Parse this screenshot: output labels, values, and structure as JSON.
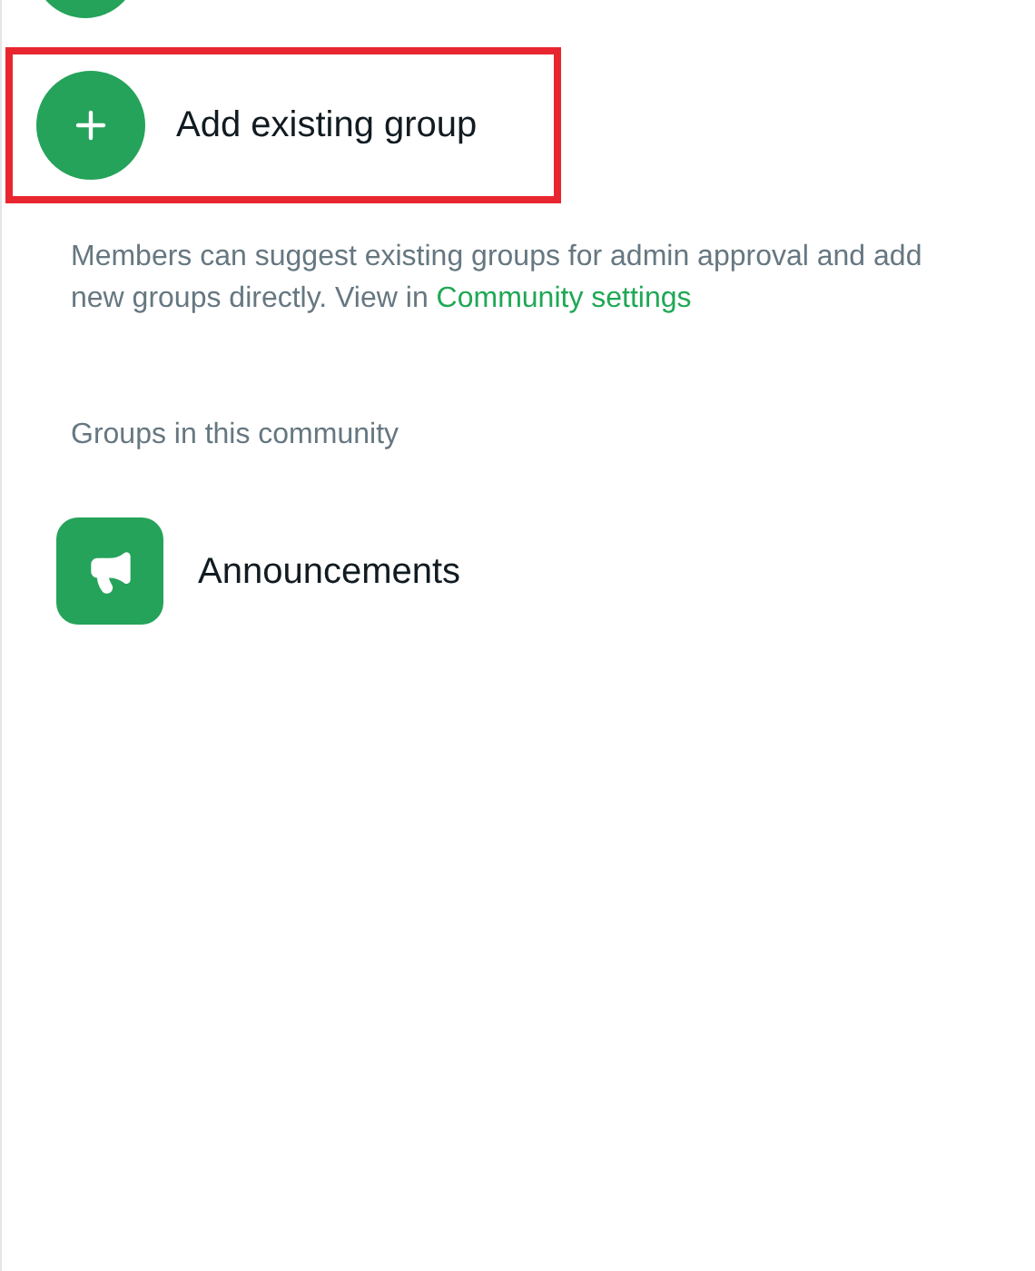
{
  "actions": [
    {
      "label": "Add existing group",
      "highlighted": true
    }
  ],
  "info": {
    "text": "Members can suggest existing groups for admin approval and add new groups directly. View in ",
    "link": "Community settings"
  },
  "groups_section": {
    "heading": "Groups in this community",
    "groups": [
      {
        "name": "Announcements"
      }
    ]
  }
}
